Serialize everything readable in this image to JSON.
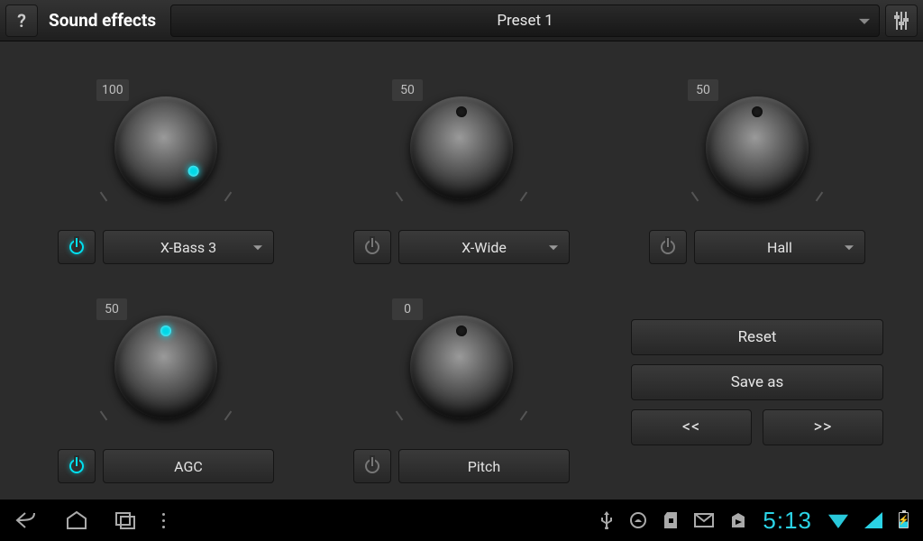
{
  "header": {
    "title": "Sound effects",
    "preset_label": "Preset 1"
  },
  "modules": {
    "xbass": {
      "value": "100",
      "label": "X-Bass 3",
      "power_on": true,
      "angle": 130,
      "has_caret": true
    },
    "xwide": {
      "value": "50",
      "label": "X-Wide",
      "power_on": false,
      "angle": 0,
      "has_caret": true
    },
    "reverb": {
      "value": "50",
      "label": "Hall",
      "power_on": false,
      "angle": 0,
      "has_caret": true
    },
    "agc": {
      "value": "50",
      "label": "AGC",
      "power_on": true,
      "angle": 0,
      "has_caret": false
    },
    "pitch": {
      "value": "0",
      "label": "Pitch",
      "power_on": false,
      "angle": 0,
      "has_caret": false
    }
  },
  "buttons": {
    "reset": "Reset",
    "save_as": "Save as",
    "prev": "<<",
    "next": ">>"
  },
  "status": {
    "clock": "5:13"
  }
}
